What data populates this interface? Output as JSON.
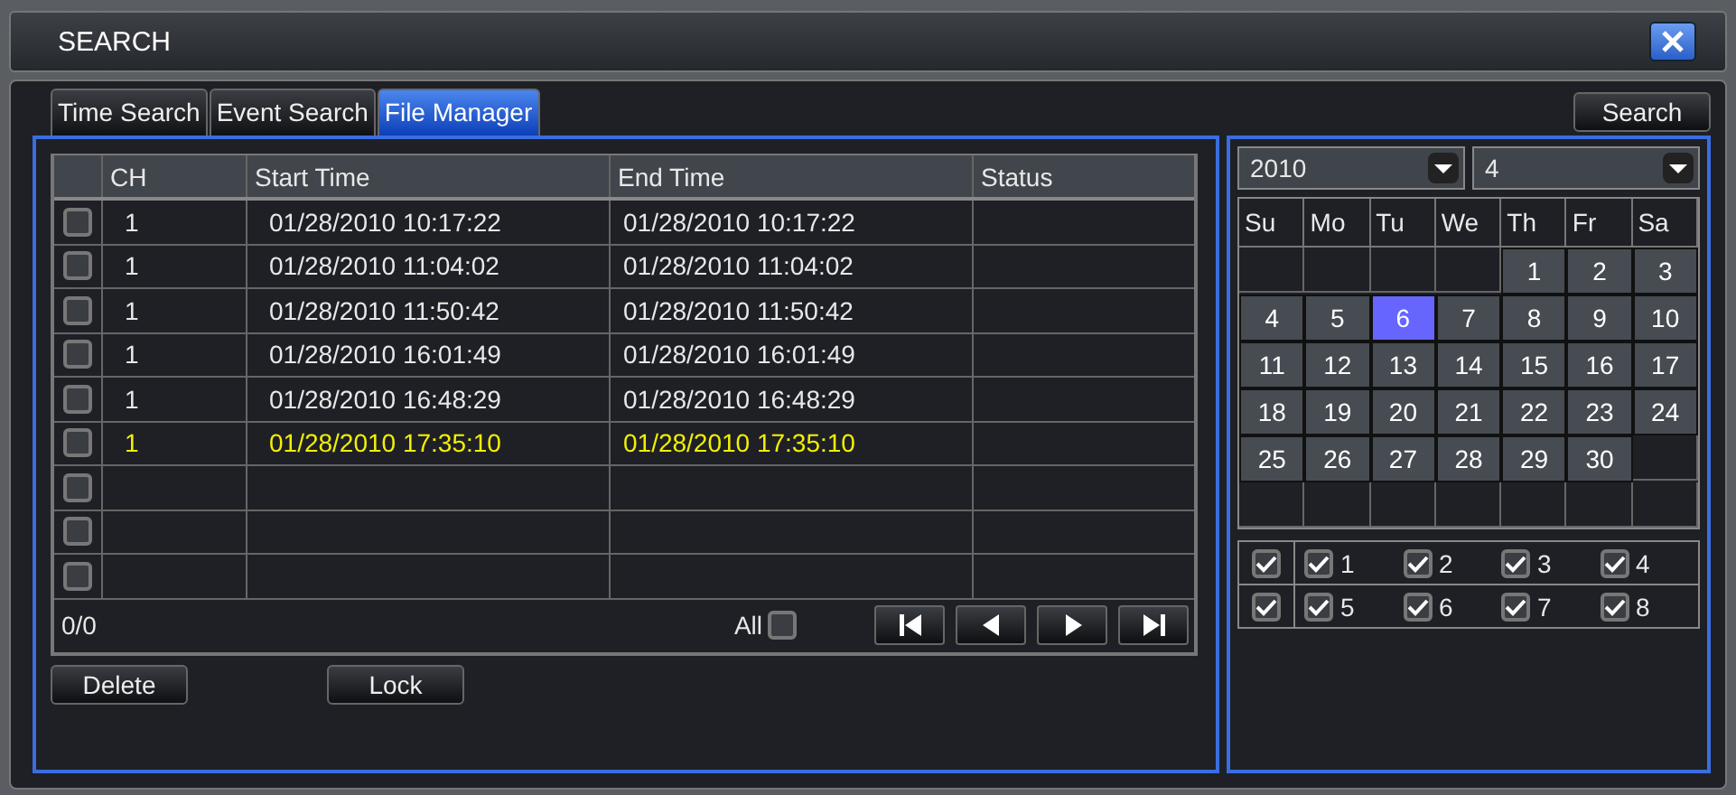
{
  "window": {
    "title": "SEARCH"
  },
  "tabs": [
    {
      "label": "Time Search",
      "selected": false
    },
    {
      "label": "Event Search",
      "selected": false
    },
    {
      "label": "File Manager",
      "selected": true
    }
  ],
  "search_button": "Search",
  "table": {
    "columns": [
      "CH",
      "Start Time",
      "End Time",
      "Status"
    ],
    "rows": [
      {
        "checked": false,
        "selected": false,
        "cells": [
          "1",
          "01/28/2010  10:17:22",
          "01/28/2010  10:17:22"
        ]
      },
      {
        "checked": false,
        "selected": false,
        "cells": [
          "1",
          "01/28/2010  11:04:02",
          "01/28/2010  11:04:02"
        ]
      },
      {
        "checked": false,
        "selected": false,
        "cells": [
          "1",
          "01/28/2010  11:50:42",
          "01/28/2010  11:50:42"
        ]
      },
      {
        "checked": false,
        "selected": false,
        "cells": [
          "1",
          "01/28/2010  16:01:49",
          "01/28/2010  16:01:49"
        ]
      },
      {
        "checked": false,
        "selected": false,
        "cells": [
          "1",
          "01/28/2010  16:48:29",
          "01/28/2010  16:48:29"
        ]
      },
      {
        "checked": false,
        "selected": true,
        "cells": [
          "1",
          "01/28/2010  17:35:10",
          "01/28/2010  17:35:10"
        ]
      },
      {
        "checked": false
      },
      {
        "checked": false
      },
      {
        "checked": false
      }
    ]
  },
  "footer": {
    "page": "0/0",
    "all_label": "All",
    "all_checked": false
  },
  "buttons": [
    "Delete",
    "Lock"
  ],
  "calendar": {
    "year": "2010",
    "month": "4",
    "weekdays": [
      "Su",
      "Mo",
      "Tu",
      "We",
      "Th",
      "Fr",
      "Sa"
    ],
    "weeks": [
      [
        {
          "kind": "blank"
        },
        {
          "kind": "blank"
        },
        {
          "kind": "blank"
        },
        {
          "kind": "blank"
        },
        {
          "day": "1",
          "selected": false
        },
        {
          "day": "2",
          "selected": false
        },
        {
          "day": "3",
          "selected": false
        }
      ],
      [
        {
          "day": "4",
          "selected": false
        },
        {
          "day": "5",
          "selected": false
        },
        {
          "day": "6",
          "selected": true
        },
        {
          "day": "7",
          "selected": false
        },
        {
          "day": "8",
          "selected": false
        },
        {
          "day": "9",
          "selected": false
        },
        {
          "day": "10",
          "selected": false
        }
      ],
      [
        {
          "day": "11",
          "selected": false
        },
        {
          "day": "12",
          "selected": false
        },
        {
          "day": "13",
          "selected": false
        },
        {
          "day": "14",
          "selected": false
        },
        {
          "day": "15",
          "selected": false
        },
        {
          "day": "16",
          "selected": false
        },
        {
          "day": "17",
          "selected": false
        }
      ],
      [
        {
          "day": "18",
          "selected": false
        },
        {
          "day": "19",
          "selected": false
        },
        {
          "day": "20",
          "selected": false
        },
        {
          "day": "21",
          "selected": false
        },
        {
          "day": "22",
          "selected": false
        },
        {
          "day": "23",
          "selected": false
        },
        {
          "day": "24",
          "selected": false
        }
      ],
      [
        {
          "day": "25",
          "selected": false
        },
        {
          "day": "26",
          "selected": false
        },
        {
          "day": "27",
          "selected": false
        },
        {
          "day": "28",
          "selected": false
        },
        {
          "day": "29",
          "selected": false
        },
        {
          "day": "30",
          "selected": false
        },
        {
          "kind": "blank"
        }
      ],
      [
        {
          "kind": "blank"
        },
        {
          "kind": "blank"
        },
        {
          "kind": "blank"
        },
        {
          "kind": "blank"
        },
        {
          "kind": "blank"
        },
        {
          "kind": "blank"
        },
        {
          "kind": "blank"
        }
      ]
    ]
  },
  "channel_rows": [
    {
      "all_checked": true,
      "channels": [
        {
          "label": "1",
          "checked": true
        },
        {
          "label": "2",
          "checked": true
        },
        {
          "label": "3",
          "checked": true
        },
        {
          "label": "4",
          "checked": true
        }
      ]
    },
    {
      "all_checked": true,
      "channels": [
        {
          "label": "5",
          "checked": true
        },
        {
          "label": "6",
          "checked": true
        },
        {
          "label": "7",
          "checked": true
        },
        {
          "label": "8",
          "checked": true
        }
      ]
    }
  ]
}
